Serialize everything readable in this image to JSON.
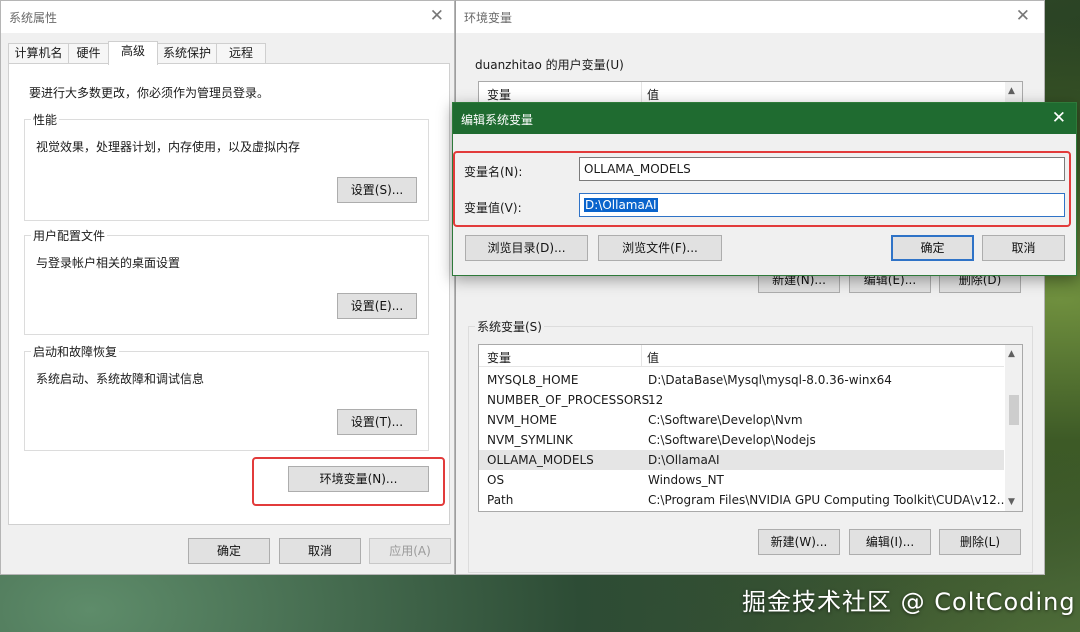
{
  "sysprops": {
    "title": "系统属性",
    "close": "✕",
    "tabs": [
      "计算机名",
      "硬件",
      "高级",
      "系统保护",
      "远程"
    ],
    "admin_note": "要进行大多数更改，你必须作为管理员登录。",
    "performance": {
      "legend": "性能",
      "desc": "视觉效果，处理器计划，内存使用，以及虚拟内存",
      "button": "设置(S)..."
    },
    "profiles": {
      "legend": "用户配置文件",
      "desc": "与登录帐户相关的桌面设置",
      "button": "设置(E)..."
    },
    "startup": {
      "legend": "启动和故障恢复",
      "desc": "系统启动、系统故障和调试信息",
      "button": "设置(T)..."
    },
    "env_button": "环境变量(N)...",
    "ok": "确定",
    "cancel": "取消",
    "apply": "应用(A)"
  },
  "envvars": {
    "title": "环境变量",
    "close": "✕",
    "user_section": "duanzhitao 的用户变量(U)",
    "col_var": "变量",
    "col_val": "值",
    "user_new": "新建(N)...",
    "user_edit": "编辑(E)...",
    "user_delete": "删除(D)",
    "sys_section": "系统变量(S)",
    "sys_rows": [
      {
        "name": "MYSQL8_HOME",
        "value": "D:\\DataBase\\Mysql\\mysql-8.0.36-winx64"
      },
      {
        "name": "NUMBER_OF_PROCESSORS",
        "value": "12"
      },
      {
        "name": "NVM_HOME",
        "value": "C:\\Software\\Develop\\Nvm"
      },
      {
        "name": "NVM_SYMLINK",
        "value": "C:\\Software\\Develop\\Nodejs"
      },
      {
        "name": "OLLAMA_MODELS",
        "value": "D:\\OllamaAI"
      },
      {
        "name": "OS",
        "value": "Windows_NT"
      },
      {
        "name": "Path",
        "value": "C:\\Program Files\\NVIDIA GPU Computing Toolkit\\CUDA\\v12...."
      }
    ],
    "sys_new": "新建(W)...",
    "sys_edit": "编辑(I)...",
    "sys_delete": "删除(L)"
  },
  "edit_dialog": {
    "title": "编辑系统变量",
    "close": "✕",
    "name_label": "变量名(N):",
    "name_value": "OLLAMA_MODELS",
    "value_label": "变量值(V):",
    "value_value": "D:\\OllamaAI",
    "browse_dir": "浏览目录(D)...",
    "browse_file": "浏览文件(F)...",
    "ok": "确定",
    "cancel": "取消"
  },
  "watermark": "掘金技术社区 @ ColtCoding",
  "colors": {
    "highlight_box": "#e23b3b",
    "dialog_title": "#1f6b30",
    "selection": "#0a64cc"
  }
}
